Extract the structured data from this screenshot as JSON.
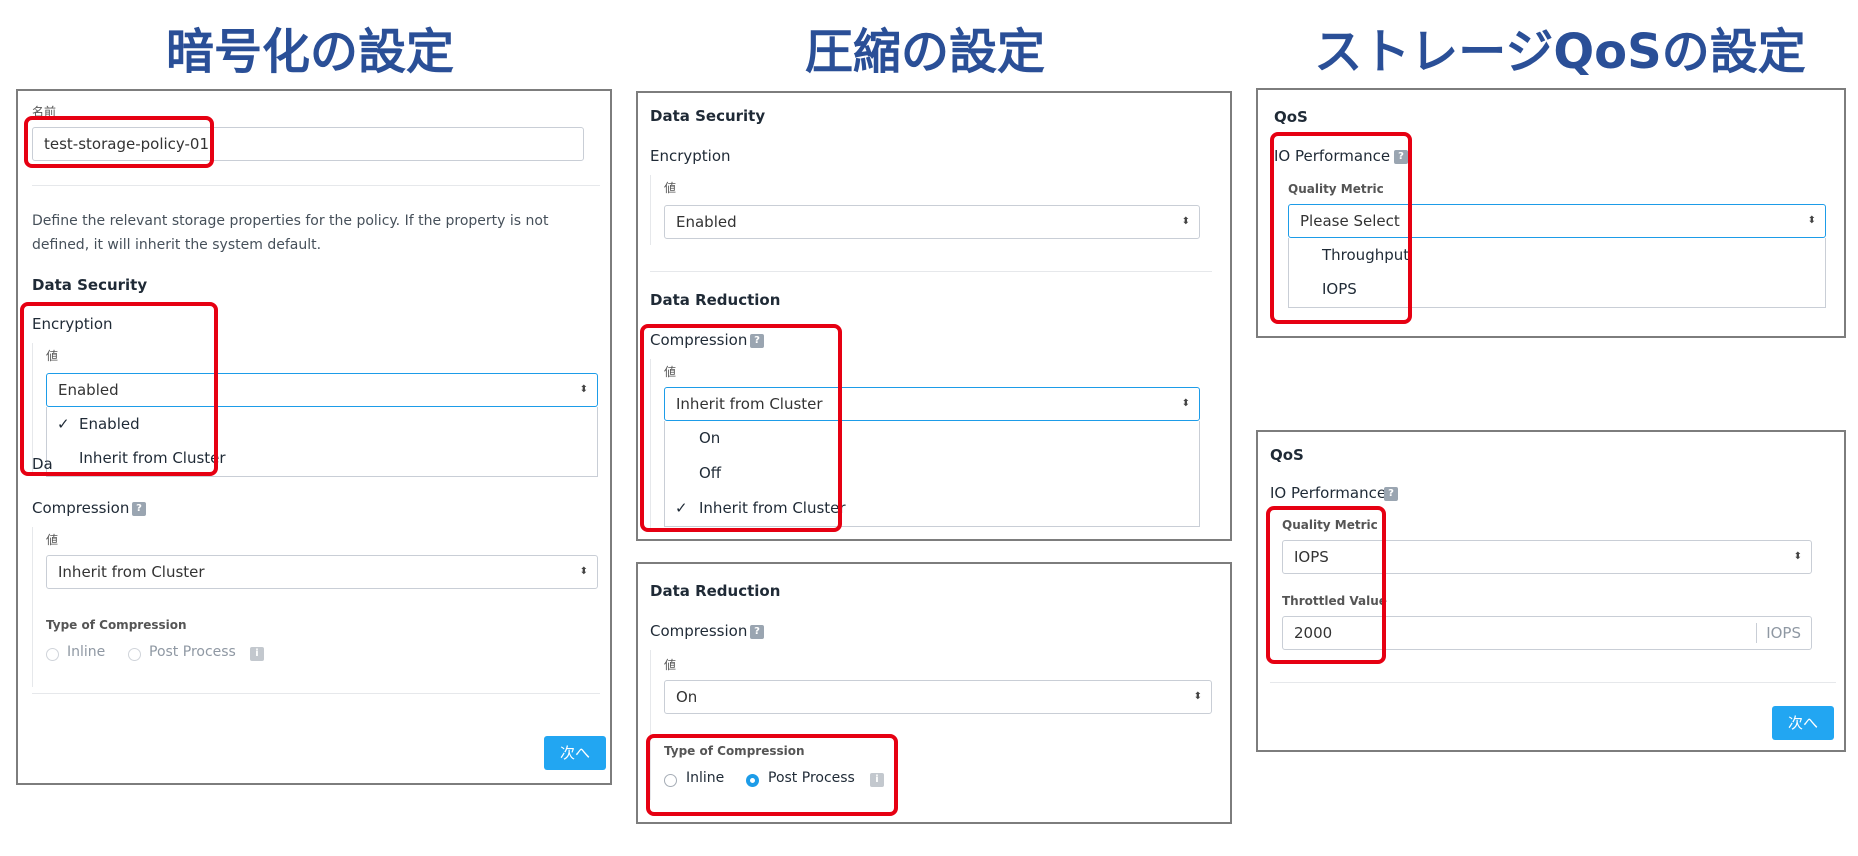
{
  "headings": {
    "encryption": "暗号化の設定",
    "compression": "圧縮の設定",
    "qos": "ストレージQoSの設定"
  },
  "encryption_panel": {
    "name_label": "名前",
    "name_value": "test-storage-policy-01",
    "description": "Define the relevant storage properties for the policy. If the property is not defined, it will inherit the system default.",
    "data_security": "Data Security",
    "encryption_label": "Encryption",
    "value_label": "値",
    "encryption_selected": "Enabled",
    "options": [
      "Enabled",
      "Inherit from Cluster"
    ],
    "checked_option": "Enabled",
    "data_reduction_partial": "Da",
    "compression_label": "Compression",
    "compression_value_label": "値",
    "compression_selected": "Inherit from Cluster",
    "type_of_compression": "Type of Compression",
    "radio_inline": "Inline",
    "radio_post_process": "Post Process",
    "next_button": "次へ"
  },
  "compression_panel_top": {
    "data_security": "Data Security",
    "encryption_label": "Encryption",
    "value_label": "値",
    "encryption_selected": "Enabled",
    "data_reduction": "Data Reduction",
    "compression_label": "Compression",
    "compression_value_label": "値",
    "compression_selected": "Inherit from Cluster",
    "options": [
      "On",
      "Off",
      "Inherit from Cluster"
    ],
    "checked_option": "Inherit from Cluster"
  },
  "compression_panel_bottom": {
    "data_reduction": "Data Reduction",
    "compression_label": "Compression",
    "value_label": "値",
    "compression_selected": "On",
    "type_of_compression": "Type of Compression",
    "radio_inline": "Inline",
    "radio_post_process": "Post Process",
    "selected_radio": "Post Process"
  },
  "qos_panel_top": {
    "qos": "QoS",
    "io_performance": "IO Performance",
    "quality_metric": "Quality Metric",
    "selected": "Please Select",
    "options": [
      "Throughput",
      "IOPS"
    ]
  },
  "qos_panel_bottom": {
    "qos": "QoS",
    "io_performance": "IO Performance",
    "quality_metric": "Quality Metric",
    "selected": "IOPS",
    "throttled_value_label": "Throttled Value",
    "throttled_value": "2000",
    "unit": "IOPS",
    "next_button": "次へ"
  },
  "icons": {
    "help": "?",
    "info": "i",
    "check": "✓",
    "select_arrow": "⬍"
  },
  "colors": {
    "heading": "#2a4f97",
    "highlight": "#e60012",
    "accent": "#1d9ce8",
    "button": "#22a6f2"
  }
}
